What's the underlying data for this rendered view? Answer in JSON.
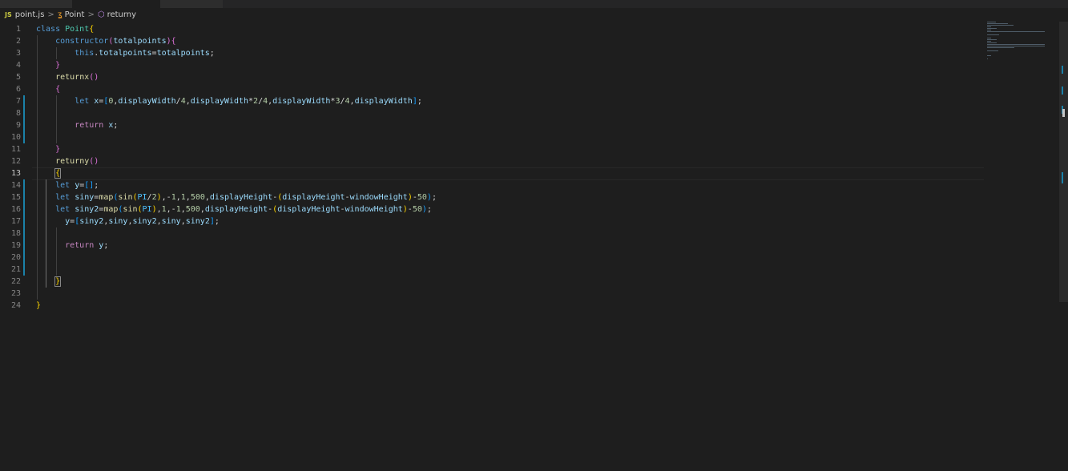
{
  "breadcrumb": {
    "file_badge": "JS",
    "file": "point.js",
    "sep1": ">",
    "class_icon": "class-icon",
    "class_name": "Point",
    "sep2": ">",
    "method_icon": "method-icon",
    "method_name": "returny"
  },
  "editor": {
    "active_line": 13,
    "lines": [
      {
        "n": "1",
        "tokens": [
          [
            "kw",
            "class "
          ],
          [
            "cls",
            "Point"
          ],
          [
            "b1",
            "{"
          ]
        ]
      },
      {
        "n": "2",
        "tokens": [
          [
            "",
            "    "
          ],
          [
            "kw",
            "constructor"
          ],
          [
            "b2",
            "("
          ],
          [
            "var",
            "totalpoints"
          ],
          [
            "b2",
            ")"
          ],
          [
            "b2",
            "{"
          ]
        ]
      },
      {
        "n": "3",
        "tokens": [
          [
            "",
            "        "
          ],
          [
            "kw",
            "this"
          ],
          [
            "",
            "."
          ],
          [
            "var",
            "totalpoints"
          ],
          [
            "",
            "="
          ],
          [
            "var",
            "totalpoints"
          ],
          [
            "",
            ";"
          ]
        ]
      },
      {
        "n": "4",
        "tokens": [
          [
            "",
            "    "
          ],
          [
            "b2",
            "}"
          ]
        ]
      },
      {
        "n": "5",
        "tokens": [
          [
            "",
            "    "
          ],
          [
            "fn",
            "returnx"
          ],
          [
            "b2",
            "()"
          ]
        ]
      },
      {
        "n": "6",
        "tokens": [
          [
            "",
            "    "
          ],
          [
            "b2",
            "{"
          ]
        ]
      },
      {
        "n": "7",
        "tokens": [
          [
            "",
            "        "
          ],
          [
            "kw",
            "let "
          ],
          [
            "var",
            "x"
          ],
          [
            "",
            "="
          ],
          [
            "b3",
            "["
          ],
          [
            "num",
            "0"
          ],
          [
            "",
            ","
          ],
          [
            "var",
            "displayWidth"
          ],
          [
            "",
            "/"
          ],
          [
            "num",
            "4"
          ],
          [
            "",
            ","
          ],
          [
            "var",
            "displayWidth"
          ],
          [
            "",
            "*"
          ],
          [
            "num",
            "2"
          ],
          [
            "",
            "/"
          ],
          [
            "num",
            "4"
          ],
          [
            "",
            ","
          ],
          [
            "var",
            "displayWidth"
          ],
          [
            "",
            "*"
          ],
          [
            "num",
            "3"
          ],
          [
            "",
            "/"
          ],
          [
            "num",
            "4"
          ],
          [
            "",
            ","
          ],
          [
            "var",
            "displayWidth"
          ],
          [
            "b3",
            "]"
          ],
          [
            "",
            ";"
          ]
        ]
      },
      {
        "n": "8",
        "tokens": []
      },
      {
        "n": "9",
        "tokens": [
          [
            "",
            "        "
          ],
          [
            "kw2",
            "return "
          ],
          [
            "var",
            "x"
          ],
          [
            "",
            ";"
          ]
        ]
      },
      {
        "n": "10",
        "tokens": []
      },
      {
        "n": "11",
        "tokens": [
          [
            "",
            "    "
          ],
          [
            "b2",
            "}"
          ]
        ]
      },
      {
        "n": "12",
        "tokens": [
          [
            "",
            "    "
          ],
          [
            "fn",
            "returny"
          ],
          [
            "b2",
            "()"
          ]
        ]
      },
      {
        "n": "13",
        "tokens": [
          [
            "",
            "    "
          ],
          [
            "bm",
            "{"
          ]
        ]
      },
      {
        "n": "14",
        "tokens": [
          [
            "",
            "    "
          ],
          [
            "kw",
            "let "
          ],
          [
            "var",
            "y"
          ],
          [
            "",
            "="
          ],
          [
            "b3",
            "[]"
          ],
          [
            "",
            ";"
          ]
        ]
      },
      {
        "n": "15",
        "tokens": [
          [
            "",
            "    "
          ],
          [
            "kw",
            "let "
          ],
          [
            "var",
            "siny"
          ],
          [
            "",
            "="
          ],
          [
            "fn",
            "map"
          ],
          [
            "b3",
            "("
          ],
          [
            "fn",
            "sin"
          ],
          [
            "b1",
            "("
          ],
          [
            "const",
            "PI"
          ],
          [
            "",
            "/"
          ],
          [
            "num",
            "2"
          ],
          [
            "b1",
            ")"
          ],
          [
            "",
            ",-"
          ],
          [
            "num",
            "1"
          ],
          [
            "",
            ","
          ],
          [
            "num",
            "1"
          ],
          [
            "",
            ","
          ],
          [
            "num",
            "500"
          ],
          [
            "",
            ","
          ],
          [
            "var",
            "displayHeight"
          ],
          [
            "",
            "-"
          ],
          [
            "b1",
            "("
          ],
          [
            "var",
            "displayHeight"
          ],
          [
            "",
            "-"
          ],
          [
            "var",
            "windowHeight"
          ],
          [
            "b1",
            ")"
          ],
          [
            "",
            "-"
          ],
          [
            "num",
            "50"
          ],
          [
            "b3",
            ")"
          ],
          [
            "",
            ";"
          ]
        ]
      },
      {
        "n": "16",
        "tokens": [
          [
            "",
            "    "
          ],
          [
            "kw",
            "let "
          ],
          [
            "var",
            "siny2"
          ],
          [
            "",
            "="
          ],
          [
            "fn",
            "map"
          ],
          [
            "b3",
            "("
          ],
          [
            "fn",
            "sin"
          ],
          [
            "b1",
            "("
          ],
          [
            "const",
            "PI"
          ],
          [
            "b1",
            ")"
          ],
          [
            "",
            ","
          ],
          [
            "num",
            "1"
          ],
          [
            "",
            ",-"
          ],
          [
            "num",
            "1"
          ],
          [
            "",
            ","
          ],
          [
            "num",
            "500"
          ],
          [
            "",
            ","
          ],
          [
            "var",
            "displayHeight"
          ],
          [
            "",
            "-"
          ],
          [
            "b1",
            "("
          ],
          [
            "var",
            "displayHeight"
          ],
          [
            "",
            "-"
          ],
          [
            "var",
            "windowHeight"
          ],
          [
            "b1",
            ")"
          ],
          [
            "",
            "-"
          ],
          [
            "num",
            "50"
          ],
          [
            "b3",
            ")"
          ],
          [
            "",
            ";"
          ]
        ]
      },
      {
        "n": "17",
        "tokens": [
          [
            "",
            "      "
          ],
          [
            "var",
            "y"
          ],
          [
            "",
            "="
          ],
          [
            "b3",
            "["
          ],
          [
            "var",
            "siny2"
          ],
          [
            "",
            ","
          ],
          [
            "var",
            "siny"
          ],
          [
            "",
            ","
          ],
          [
            "var",
            "siny2"
          ],
          [
            "",
            ","
          ],
          [
            "var",
            "siny"
          ],
          [
            "",
            ","
          ],
          [
            "var",
            "siny2"
          ],
          [
            "b3",
            "]"
          ],
          [
            "",
            ";"
          ]
        ]
      },
      {
        "n": "18",
        "tokens": []
      },
      {
        "n": "19",
        "tokens": [
          [
            "",
            "      "
          ],
          [
            "kw2",
            "return "
          ],
          [
            "var",
            "y"
          ],
          [
            "",
            ";"
          ]
        ]
      },
      {
        "n": "20",
        "tokens": []
      },
      {
        "n": "21",
        "tokens": []
      },
      {
        "n": "22",
        "tokens": [
          [
            "",
            "    "
          ],
          [
            "bm",
            "}"
          ]
        ]
      },
      {
        "n": "23",
        "tokens": []
      },
      {
        "n": "24",
        "tokens": [
          [
            "b1",
            "}"
          ]
        ]
      }
    ]
  },
  "colors": {
    "background": "#1e1e1e",
    "modified_marker": "#1b81a8"
  }
}
